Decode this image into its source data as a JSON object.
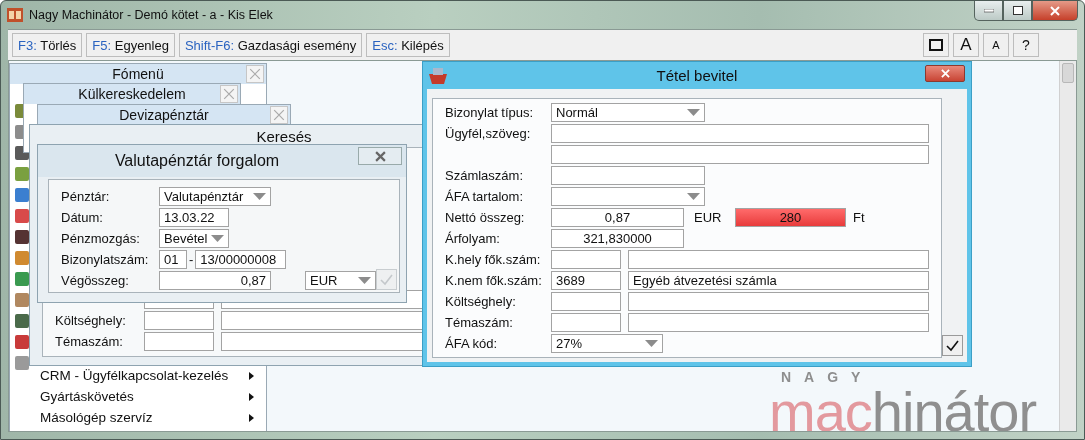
{
  "window": {
    "title": "Nagy Machinátor - Demó kötet - a - Kis Elek"
  },
  "toolbar": {
    "shortcuts": [
      {
        "key": "F3:",
        "label": "Törlés"
      },
      {
        "key": "F5:",
        "label": "Egyenleg"
      },
      {
        "key": "Shift-F6:",
        "label": "Gazdasági esemény"
      },
      {
        "key": "Esc:",
        "label": "Kilépés"
      }
    ],
    "tools": [
      {
        "kind": "icon"
      },
      {
        "kind": "larger",
        "label": "A"
      },
      {
        "kind": "smaller",
        "label": "A"
      },
      {
        "kind": "help",
        "label": "?"
      }
    ]
  },
  "menus": [
    {
      "title": "Fómenü",
      "items": [
        {
          "label": "CRM - Ügyfélkapcsolat-kezelés",
          "submenu": true
        },
        {
          "label": "Gyártáskövetés",
          "submenu": true
        },
        {
          "label": "Másológép szervíz",
          "submenu": true
        }
      ]
    },
    {
      "title": "Külkereskedelem"
    },
    {
      "title": "Devizapénztár"
    }
  ],
  "search_window": {
    "title": "Keresés",
    "rows": [
      {
        "kind": "account"
      },
      {
        "kind": "account",
        "label": "Költséghely:"
      },
      {
        "kind": "account",
        "label": "Témaszám:"
      }
    ]
  },
  "cash_window": {
    "title": "Valutapénztár forgalom",
    "confirm_disabled": true,
    "fields": [
      {
        "label": "Pénztár:",
        "kind": "dropdown",
        "value": "Valutapénztár"
      },
      {
        "label": "Dátum:",
        "kind": "text",
        "value": "13.03.22"
      },
      {
        "label": "Pénzmozgás:",
        "kind": "dropdown",
        "value": "Bevétel"
      },
      {
        "label": "Bizonylatszám:",
        "kind": "docnum",
        "prefix": "01",
        "separator": "-",
        "value": "13/00000008"
      },
      {
        "label": "Végösszeg:",
        "kind": "amount",
        "value": "0,87",
        "currency": "EUR"
      }
    ]
  },
  "entry_window": {
    "title": "Tétel bevitel",
    "rows": [
      {
        "label": "Bizonylat típus:",
        "kind": "dropdown",
        "value": "Normál"
      },
      {
        "label": "Ügyfél,szöveg:",
        "kind": "wide"
      },
      {
        "kind": "wide"
      },
      {
        "label": "Számlaszám:",
        "kind": "text"
      },
      {
        "label": "ÁFA tartalom:",
        "kind": "dropdown"
      },
      {
        "label": "Nettó összeg:",
        "kind": "amount",
        "value": "0,87",
        "currency": "EUR",
        "converted": "280",
        "converted_currency": "Ft",
        "warning": true
      },
      {
        "label": "Árfolyam:",
        "kind": "number",
        "value": "321,830000"
      },
      {
        "label": "K.hely fők.szám:",
        "kind": "account"
      },
      {
        "label": "K.nem fők.szám:",
        "kind": "account",
        "code": "3689",
        "name": "Egyéb átvezetési számla"
      },
      {
        "label": "Költséghely:",
        "kind": "account"
      },
      {
        "label": "Témaszám:",
        "kind": "account"
      },
      {
        "label": "ÁFA kód:",
        "kind": "dropdown",
        "value": "27%"
      }
    ]
  },
  "logo": {
    "tagline": "NAGY",
    "word_start": "mac",
    "word_end": "hinátor"
  }
}
